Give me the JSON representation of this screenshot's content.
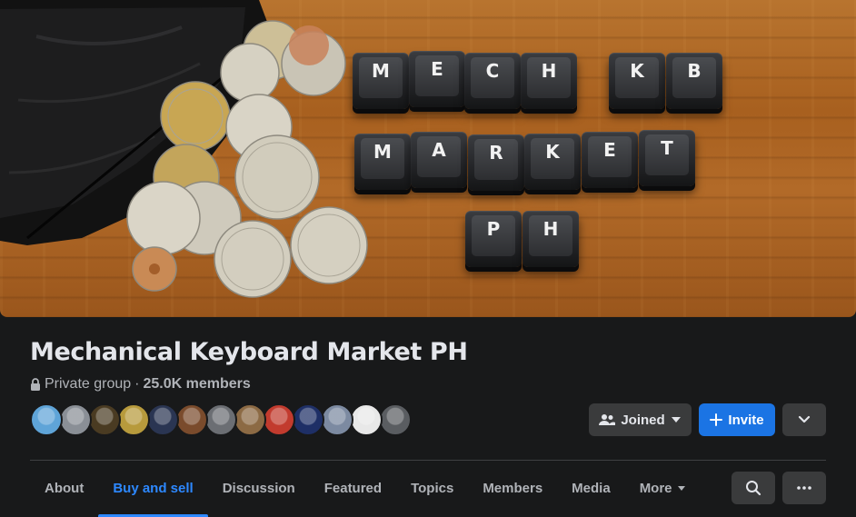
{
  "cover": {
    "keycaps_row1": [
      "M",
      "E",
      "C",
      "H",
      "K",
      "B"
    ],
    "keycaps_row2": [
      "M",
      "A",
      "R",
      "K",
      "E",
      "T"
    ],
    "keycaps_row3": [
      "P",
      "H"
    ]
  },
  "group": {
    "name": "Mechanical Keyboard Market PH",
    "privacy": "Private group",
    "separator": "·",
    "members": "25.0K members"
  },
  "member_avatars": [
    {
      "color": "#5fa4d8"
    },
    {
      "color": "#8a8f96"
    },
    {
      "color": "#4a3b22"
    },
    {
      "color": "#b79a3c"
    },
    {
      "color": "#2a3552"
    },
    {
      "color": "#7a4b2c"
    },
    {
      "color": "#6b6e73"
    },
    {
      "color": "#8c6a44"
    },
    {
      "color": "#c23b2e"
    },
    {
      "color": "#1e2f66"
    },
    {
      "color": "#7c8aa1"
    },
    {
      "color": "#e8e8e8"
    },
    {
      "color": "#5a5d61"
    }
  ],
  "actions": {
    "joined_label": "Joined",
    "invite_label": "Invite"
  },
  "tabs": [
    {
      "label": "About",
      "active": false
    },
    {
      "label": "Buy and sell",
      "active": true
    },
    {
      "label": "Discussion",
      "active": false
    },
    {
      "label": "Featured",
      "active": false
    },
    {
      "label": "Topics",
      "active": false
    },
    {
      "label": "Members",
      "active": false
    },
    {
      "label": "Media",
      "active": false
    },
    {
      "label": "More",
      "active": false
    }
  ],
  "colors": {
    "background": "#18191a",
    "accent": "#2d88ff",
    "invite_button": "#1b74e4",
    "secondary_button": "#3a3b3c"
  },
  "icons": {
    "lock": "lock-icon",
    "joined": "people-icon",
    "invite": "plus-icon",
    "expand": "chevron-down-icon",
    "search": "search-icon",
    "more": "ellipsis-icon"
  }
}
